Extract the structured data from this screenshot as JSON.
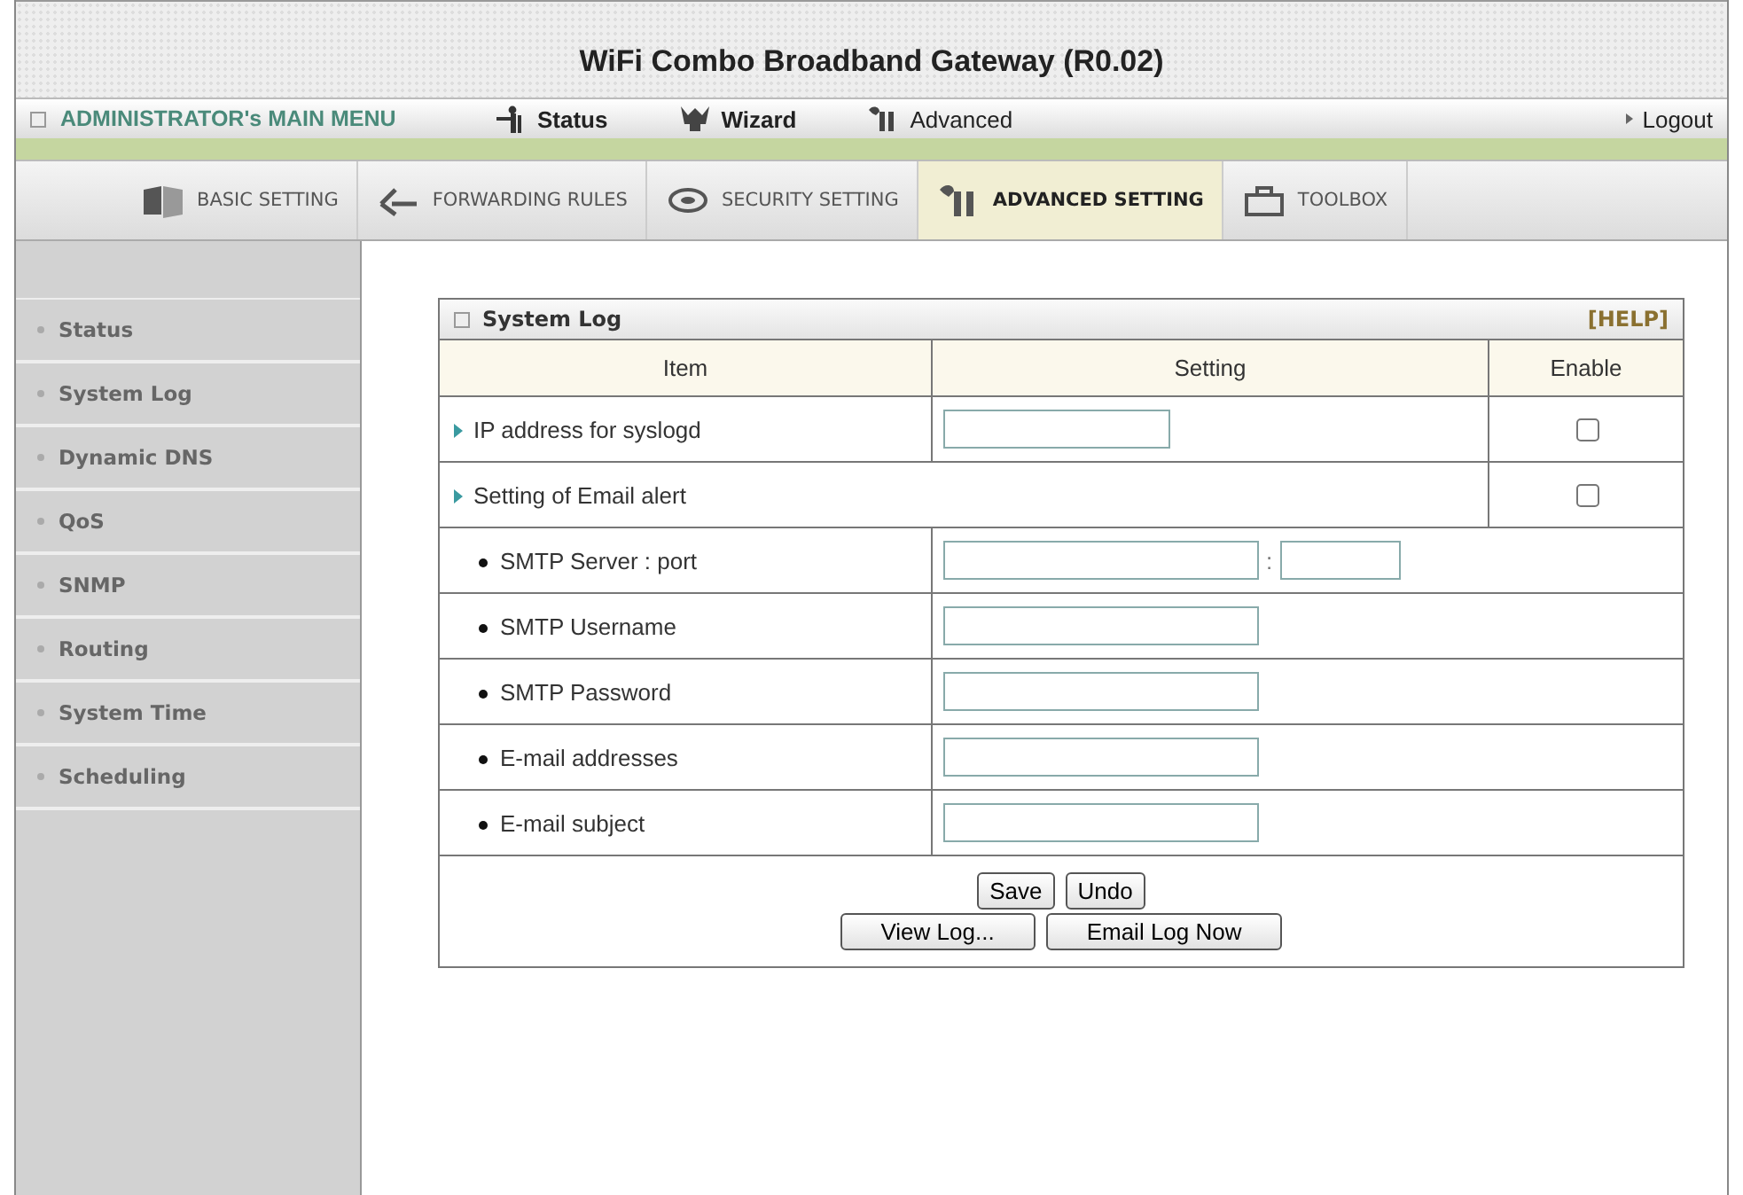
{
  "window": {
    "title": "WiFi Combo Broadband Gateway (R0.02)"
  },
  "menu_bar": {
    "main_menu": "ADMINISTRATOR's MAIN MENU",
    "items": [
      {
        "label": "Status"
      },
      {
        "label": "Wizard"
      },
      {
        "label": "Advanced"
      }
    ],
    "logout": "Logout"
  },
  "tabs": [
    {
      "label": "BASIC SETTING",
      "selected": false
    },
    {
      "label": "FORWARDING RULES",
      "selected": false
    },
    {
      "label": "SECURITY SETTING",
      "selected": false
    },
    {
      "label": "ADVANCED SETTING",
      "selected": true
    },
    {
      "label": "TOOLBOX",
      "selected": false
    }
  ],
  "sidebar": {
    "items": [
      "Status",
      "System Log",
      "Dynamic DNS",
      "QoS",
      "SNMP",
      "Routing",
      "System Time",
      "Scheduling"
    ]
  },
  "panel": {
    "title": "System Log",
    "help": "[HELP]",
    "columns": [
      "Item",
      "Setting",
      "Enable"
    ],
    "rows": [
      {
        "kind": "field",
        "label": "IP address for syslogd",
        "checked": false
      },
      {
        "kind": "toggle",
        "label": "Setting of Email alert",
        "checked": false
      },
      {
        "kind": "hostport",
        "label": "SMTP Server : port",
        "separator": ":"
      },
      {
        "kind": "text",
        "label": "SMTP Username"
      },
      {
        "kind": "text",
        "label": "SMTP Password"
      },
      {
        "kind": "text",
        "label": "E-mail addresses"
      },
      {
        "kind": "text",
        "label": "E-mail subject"
      }
    ],
    "buttons": [
      [
        "Save",
        "Undo"
      ],
      [
        "View Log...",
        "Email Log Now"
      ]
    ]
  }
}
